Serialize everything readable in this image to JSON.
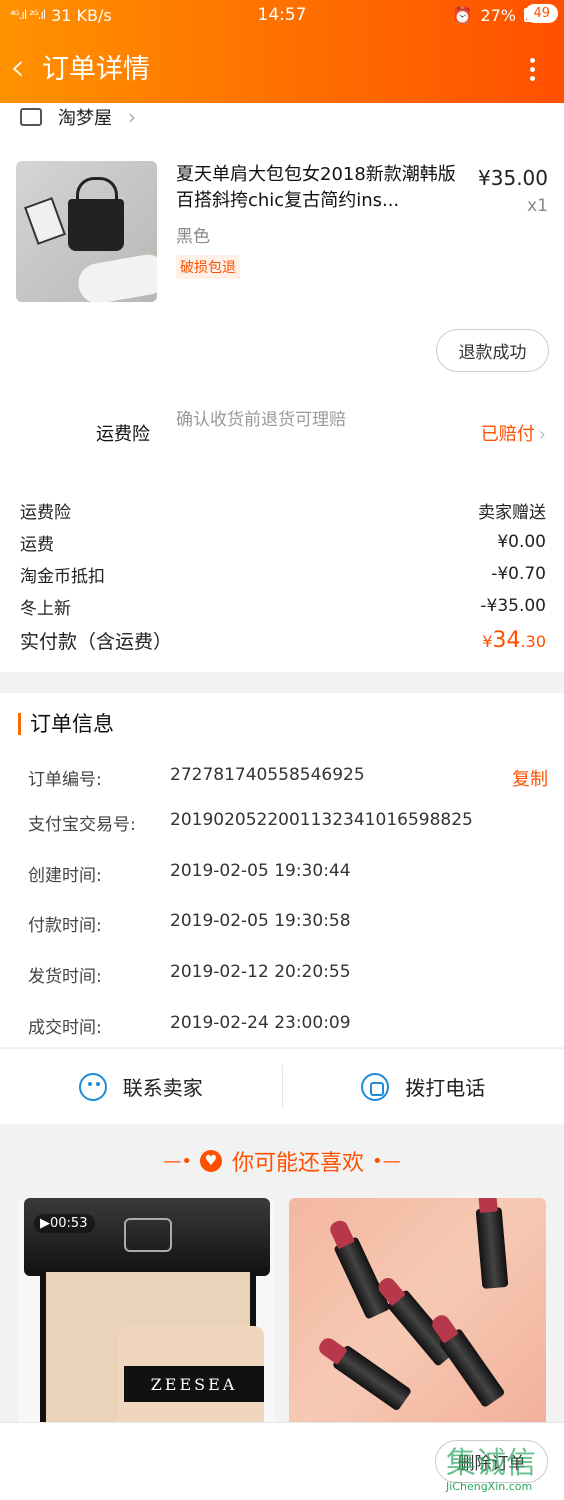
{
  "status_bar": {
    "network": "31 KB/s",
    "signal": "⁴ᴳ.ıl ²ᴳ.ıl",
    "time": "14:57",
    "battery": "27%",
    "battery_level": 0.27
  },
  "header": {
    "back_icon": "chevron-left-icon",
    "title": "订单详情",
    "menu_icon": "more-vertical-icon",
    "badge": "49"
  },
  "shop": {
    "name": "淘梦屋",
    "icon": "shop-icon"
  },
  "product": {
    "title": "夏天单肩大包包女2018新款潮韩版 百搭斜挎chic复古简约ins...",
    "price": "¥35.00",
    "qty": "x1",
    "variant": "黑色",
    "tag": "破损包退",
    "refund_status": "退款成功"
  },
  "insurance": {
    "label": "运费险",
    "desc": "确认收货前退货可理赔",
    "status": "已赔付"
  },
  "fees": [
    {
      "label": "运费险",
      "value": "卖家赠送"
    },
    {
      "label": "运费",
      "value": "¥0.00"
    },
    {
      "label": "淘金币抵扣",
      "value": "-¥0.70"
    },
    {
      "label": "冬上新",
      "value": "-¥35.00"
    }
  ],
  "total": {
    "label": "实付款（含运费）",
    "currency": "¥",
    "integer": "34",
    "decimal": ".30"
  },
  "order_info": {
    "title": "订单信息",
    "copy": "复制",
    "rows": [
      {
        "k": "订单编号:",
        "v": "272781740558546925"
      },
      {
        "k": "支付宝交易号:",
        "v": "2019020522001132341016598825"
      },
      {
        "k": "创建时间:",
        "v": "2019-02-05 19:30:44"
      },
      {
        "k": "付款时间:",
        "v": "2019-02-05 19:30:58"
      },
      {
        "k": "发货时间:",
        "v": "2019-02-12 20:20:55"
      },
      {
        "k": "成交时间:",
        "v": "2019-02-24 23:00:09"
      }
    ]
  },
  "contact": {
    "seller": "联系卖家",
    "phone": "拨打电话"
  },
  "recommend": {
    "title": "你可能还喜欢",
    "left_line": "—•",
    "right_line": "•—",
    "items": [
      {
        "video": "▶00:53",
        "brand": "ZEESEA"
      },
      {
        "brand": ""
      }
    ]
  },
  "bottom": {
    "delete": "删除订单"
  },
  "watermark": {
    "text": "JiChengXin.com",
    "big": "集诚信"
  },
  "colors": {
    "accent": "#ff5000",
    "header_start": "#ff9200",
    "header_end": "#ff5000",
    "link_blue": "#1e8cd8"
  }
}
